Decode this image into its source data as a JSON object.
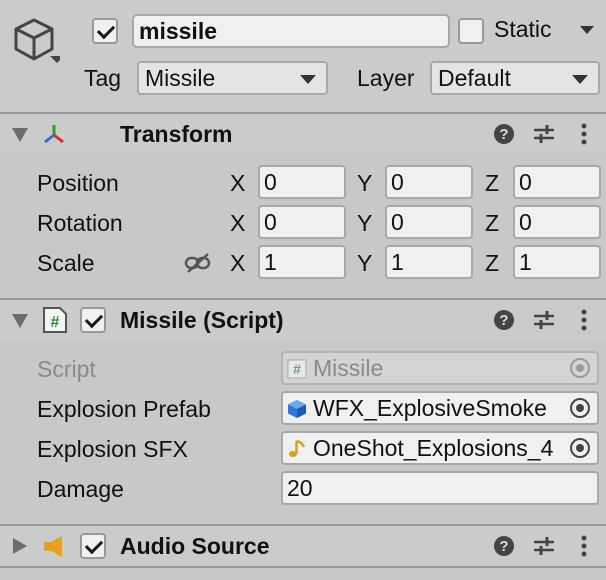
{
  "gameobject": {
    "active": true,
    "name": "missile",
    "static_label": "Static",
    "static": false,
    "tag_label": "Tag",
    "tag_value": "Missile",
    "layer_label": "Layer",
    "layer_value": "Default",
    "icon": "cube-icon"
  },
  "transform": {
    "title": "Transform",
    "icon": "transform-axes-icon",
    "expanded": true,
    "rows": [
      {
        "label": "Position",
        "x": "0",
        "y": "0",
        "z": "0"
      },
      {
        "label": "Rotation",
        "x": "0",
        "y": "0",
        "z": "0"
      },
      {
        "label": "Scale",
        "x": "1",
        "y": "1",
        "z": "1"
      }
    ],
    "axis_labels": {
      "x": "X",
      "y": "Y",
      "z": "Z"
    }
  },
  "missile_script": {
    "title": "Missile (Script)",
    "icon": "csharp-script-icon",
    "enabled": true,
    "expanded": true,
    "fields": {
      "script": {
        "label": "Script",
        "value": "Missile",
        "icon": "hash-icon"
      },
      "explosion_prefab": {
        "label": "Explosion Prefab",
        "value": "WFX_ExplosiveSmoke",
        "icon": "prefab-cube-icon"
      },
      "explosion_sfx": {
        "label": "Explosion SFX",
        "value": "OneShot_Explosions_4",
        "icon": "audio-note-icon"
      },
      "damage": {
        "label": "Damage",
        "value": "20"
      }
    }
  },
  "audio_source": {
    "title": "Audio Source",
    "icon": "speaker-icon",
    "enabled": true,
    "expanded": false
  },
  "colors": {
    "background": "#c8c8c8",
    "field": "#f0f0f0",
    "axis_x": "#d03030",
    "axis_y": "#2fa02f",
    "axis_z": "#2f6fd0",
    "audio_orange": "#e8a020"
  }
}
